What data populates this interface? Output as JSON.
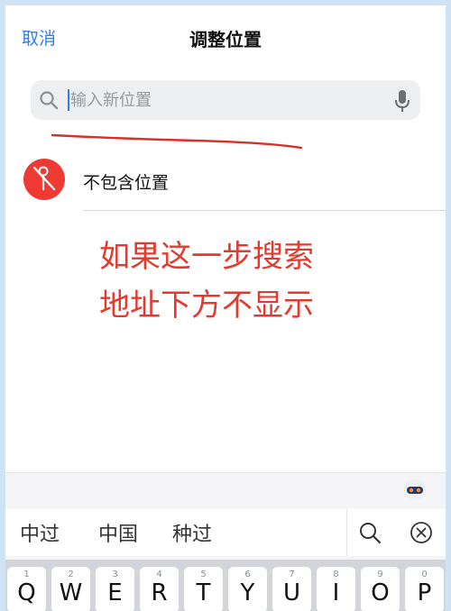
{
  "nav": {
    "cancel": "取消",
    "title": "调整位置"
  },
  "search": {
    "placeholder": "输入新位置",
    "value": ""
  },
  "list": {
    "no_location": "不包含位置"
  },
  "annotation": {
    "line1": "如果这一步搜索",
    "line2": "地址下方不显示"
  },
  "keyboard": {
    "suggestions": [
      "中过",
      "中国",
      "种过"
    ],
    "row1": [
      {
        "num": "1",
        "key": "Q"
      },
      {
        "num": "2",
        "key": "W"
      },
      {
        "num": "3",
        "key": "E"
      },
      {
        "num": "4",
        "key": "R"
      },
      {
        "num": "5",
        "key": "T"
      },
      {
        "num": "6",
        "key": "Y"
      },
      {
        "num": "7",
        "key": "U"
      },
      {
        "num": "8",
        "key": "I"
      },
      {
        "num": "9",
        "key": "O"
      },
      {
        "num": "0",
        "key": "P"
      }
    ]
  },
  "colors": {
    "accent": "#2f7cf6",
    "pin": "#ee3a32",
    "annotation": "#e23a2e"
  },
  "icons": [
    "search-icon",
    "microphone-icon",
    "location-off-icon",
    "keyboard-assistant-icon",
    "keyboard-search-icon",
    "clear-icon"
  ]
}
